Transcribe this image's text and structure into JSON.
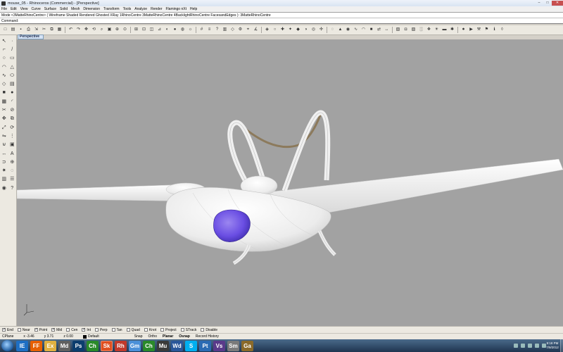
{
  "window": {
    "title": "mouse_05 - Rhinoceros (Commercial) - [Perspective]",
    "minimize": "–",
    "maximize": "□",
    "close": "✕",
    "app_icon": "rhino-icon"
  },
  "menu": [
    "File",
    "Edit",
    "View",
    "Curve",
    "Surface",
    "Solid",
    "Mesh",
    "Dimension",
    "Transform",
    "Tools",
    "Analyze",
    "Render",
    "Flamingo nXt",
    "Help"
  ],
  "command_history": "Mode <3MatteRhinoCentre> ( Wireframe  Shaded  Rendered  Ghosted  XRay  1RhinoCentre  3MatteRhinoCentre  4BacklightRhinoCentre  FacesandEdges ): 3MatteRhinoCentre",
  "command": {
    "label": "Command:",
    "value": ""
  },
  "viewport": {
    "tab_label": "Perspective",
    "background": "#a2a2a2"
  },
  "osnap": [
    {
      "label": "End",
      "checked": true
    },
    {
      "label": "Near",
      "checked": false
    },
    {
      "label": "Point",
      "checked": true
    },
    {
      "label": "Mid",
      "checked": true
    },
    {
      "label": "Cen",
      "checked": false
    },
    {
      "label": "Int",
      "checked": true
    },
    {
      "label": "Perp",
      "checked": false
    },
    {
      "label": "Tan",
      "checked": false
    },
    {
      "label": "Quad",
      "checked": false
    },
    {
      "label": "Knot",
      "checked": false
    },
    {
      "label": "Project",
      "checked": false
    },
    {
      "label": "STrack",
      "checked": false
    },
    {
      "label": "Disable",
      "checked": false
    }
  ],
  "status": {
    "cplane": "CPlane",
    "x": "x -3.46",
    "y": "y 3.71",
    "z": "z 0.00",
    "layer": "Default",
    "panes": [
      "Snap",
      "Ortho",
      "Planar",
      "Osnap",
      "Record History"
    ],
    "bold_panes": [
      "Planar",
      "Osnap"
    ]
  },
  "taskbar": {
    "apps": [
      "IE",
      "FF",
      "Ex",
      "Md",
      "Ps",
      "Ch",
      "Sk",
      "Rh",
      "Gm",
      "Ch",
      "Mu",
      "Wd",
      "S",
      "Pt",
      "Vs",
      "Sm",
      "Ga"
    ],
    "time": "9:18 PM",
    "date": "7/9/2012"
  },
  "toolbar_icons": [
    "new-icon",
    "open-icon",
    "save-icon",
    "print-icon",
    "import-icon",
    "cut-icon",
    "copy-icon",
    "paste-icon",
    "undo-icon",
    "redo-icon",
    "pan-icon",
    "rotate-view-icon",
    "zoom-icon",
    "zoom-window-icon",
    "zoom-extents-icon",
    "zoom-selected-icon",
    "four-viewports-icon",
    "select-icon",
    "named-view-icon",
    "cplane-icon",
    "shade-icon",
    "render-icon",
    "material-icon",
    "light-icon",
    "grid-icon",
    "properties-icon",
    "help-icon",
    "layer-icon",
    "object-props-icon",
    "options-icon",
    "snap-icon",
    "analyze-icon",
    "mesh-icon",
    "sphere-icon",
    "osnap-icon",
    "flamingo-icon",
    "rhino-logo-icon",
    "shaded-icon",
    "globe-icon",
    "gumball-icon",
    "hide-icon",
    "lock-icon",
    "show-icon",
    "curve-icon",
    "surface-icon",
    "solid-icon",
    "transform-icon",
    "dimension-icon",
    "render-preview-icon",
    "camera-icon",
    "section-icon",
    "texture-icon",
    "environment-icon",
    "sun-icon",
    "ground-icon",
    "plugin-icon",
    "record-icon",
    "video-icon",
    "settings-icon",
    "tools-icon",
    "info-icon",
    "extra-icon"
  ]
}
